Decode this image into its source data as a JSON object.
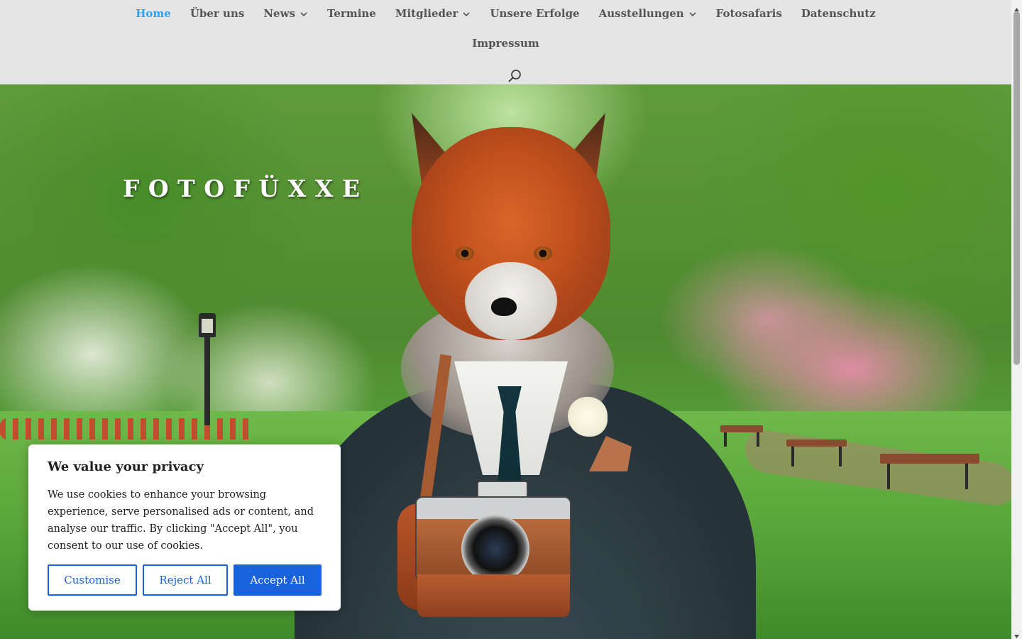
{
  "nav": {
    "row1": [
      {
        "label": "Home",
        "active": true,
        "dropdown": false,
        "name": "nav-item-home"
      },
      {
        "label": "Über uns",
        "active": false,
        "dropdown": false,
        "name": "nav-item-ueber-uns"
      },
      {
        "label": "News",
        "active": false,
        "dropdown": true,
        "name": "nav-item-news"
      },
      {
        "label": "Termine",
        "active": false,
        "dropdown": false,
        "name": "nav-item-termine"
      },
      {
        "label": "Mitglieder",
        "active": false,
        "dropdown": true,
        "name": "nav-item-mitglieder"
      },
      {
        "label": "Unsere Erfolge",
        "active": false,
        "dropdown": false,
        "name": "nav-item-unsere-erfolge"
      },
      {
        "label": "Ausstellungen",
        "active": false,
        "dropdown": true,
        "name": "nav-item-ausstellungen"
      },
      {
        "label": "Fotosafaris",
        "active": false,
        "dropdown": false,
        "name": "nav-item-fotosafaris"
      },
      {
        "label": "Datenschutz",
        "active": false,
        "dropdown": false,
        "name": "nav-item-datenschutz"
      }
    ],
    "row2": [
      {
        "label": "Impressum",
        "active": false,
        "dropdown": false,
        "name": "nav-item-impressum"
      }
    ],
    "search_icon": "search-icon"
  },
  "hero": {
    "title": "FOTOFÜXXE"
  },
  "cookie": {
    "title": "We value your privacy",
    "text": "We use cookies to enhance your browsing experience, serve personalised ads or content, and analyse our traffic. By clicking \"Accept All\", you consent to our use of cookies.",
    "customise_label": "Customise",
    "reject_label": "Reject All",
    "accept_label": "Accept All"
  },
  "colors": {
    "header_bg": "#e4e4e4",
    "nav_text": "#555555",
    "nav_active": "#2ea3f2",
    "cookie_accent": "#1863dc"
  }
}
